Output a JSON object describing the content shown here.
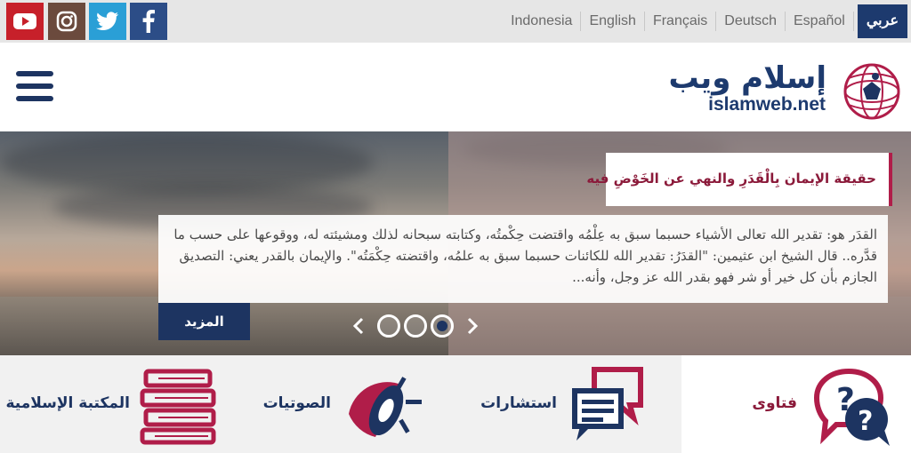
{
  "social": {
    "youtube": "youtube-icon",
    "instagram": "instagram-icon",
    "twitter": "twitter-icon",
    "facebook": "facebook-icon"
  },
  "languages": [
    "Indonesia",
    "English",
    "Français",
    "Deutsch",
    "Español",
    "عربي"
  ],
  "header": {
    "logo_arabic": "إسلام ويب",
    "logo_latin": "islamweb.net"
  },
  "hero": {
    "title": "حقيقة الإيمان بِالْقَدَرِ والنهي عن الخَوْضِ فيه",
    "body": "القدَر هو: تقدير الله تعالى الأشياء حسبما سبق به عِلْمُه واقتضت حِكْمتُه، وكتابته سبحانه لذلك ومشيئته له، ووقوعها على حسب ما قدَّره.. قال الشيخ ابن عثيمين: \"القدَرُ: تقدير الله للكائنات حسبما سبق به علمُه، واقتضته حِكْمَتُه\". والإيمان بالقدر يعني: التصديق الجازم بأن كل خير أو شر فهو بقدر الله عز وجل، وأنه...",
    "more_label": "المزيد",
    "pager_total": 3,
    "pager_active": 3
  },
  "nav": {
    "fatawa": "فتاوى",
    "istisharat": "استشارات",
    "sawtiyat": "الصوتيات",
    "library": "المكتبة الإسلامية"
  },
  "colors": {
    "navy": "#1d3461",
    "crimson": "#b01d49",
    "lang_active": "#1d3a6e"
  }
}
